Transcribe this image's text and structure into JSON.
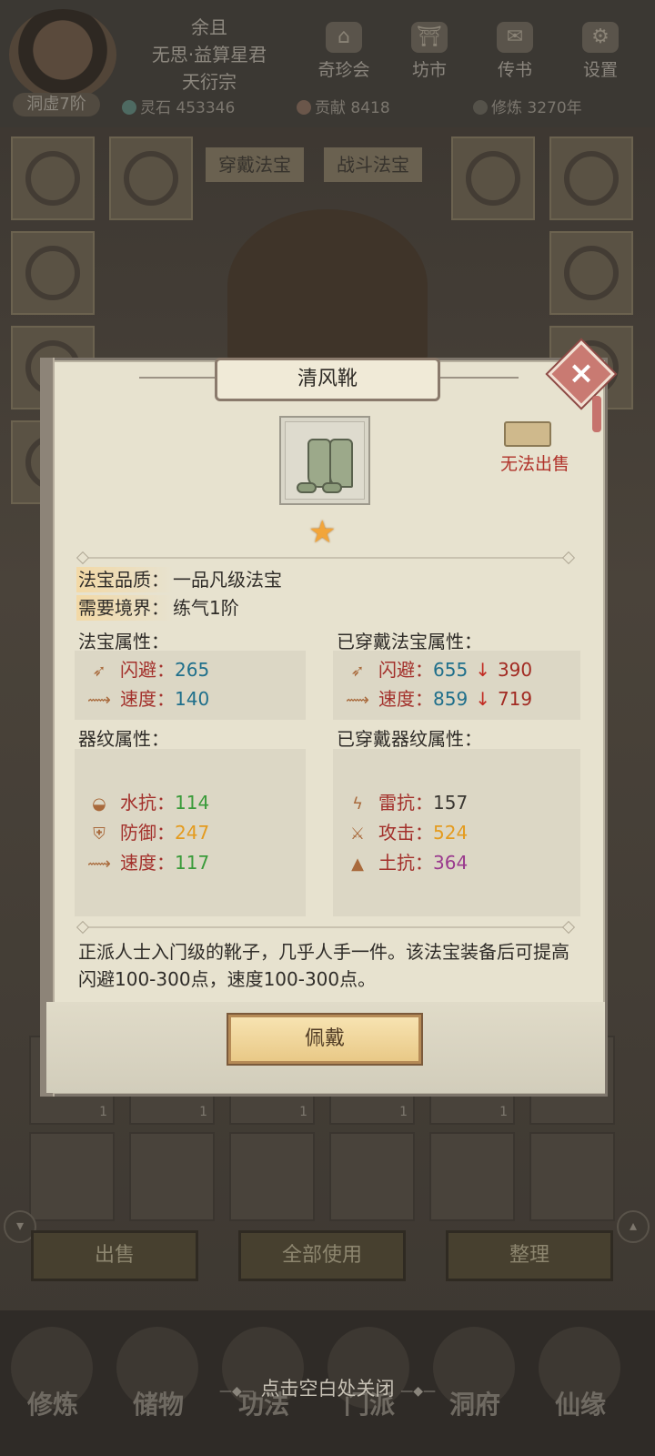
{
  "player": {
    "name": "余且",
    "title": "无思·益算星君",
    "sect": "天衍宗",
    "realm": "洞虚7阶"
  },
  "top_menu": [
    {
      "label": "奇珍会"
    },
    {
      "label": "坊市"
    },
    {
      "label": "传书"
    },
    {
      "label": "设置"
    }
  ],
  "stats": {
    "spirit_stone": "灵石 453346",
    "contribution": "贡献 8418",
    "cultivation": "修炼 3270年"
  },
  "equip_tabs": {
    "worn": "穿戴法宝",
    "battle": "战斗法宝"
  },
  "bag_buttons": {
    "sell": "出售",
    "use_all": "全部使用",
    "sort": "整理"
  },
  "bag_counts": [
    "1",
    "1",
    "1",
    "1",
    "1"
  ],
  "close_hint": "点击空白处关闭",
  "bottom_nav": [
    "修炼",
    "储物",
    "功法",
    "门派",
    "洞府",
    "仙缘"
  ],
  "modal": {
    "title": "清风靴",
    "sell_status": "无法出售",
    "quality_key": "法宝品质：",
    "quality_value": "一品凡级法宝",
    "realm_key": "需要境界：",
    "realm_value": "练气1阶",
    "item_attrs_title": "法宝属性：",
    "worn_attrs_title": "已穿戴法宝属性：",
    "item_attrs": [
      {
        "icon": "dodge-icon",
        "label": "闪避：",
        "value": "265"
      },
      {
        "icon": "speed-icon",
        "label": "速度：",
        "value": "140"
      }
    ],
    "worn_attrs": [
      {
        "icon": "dodge-icon",
        "label": "闪避：",
        "value": "655",
        "arrow": "↓",
        "diff": "390"
      },
      {
        "icon": "speed-icon",
        "label": "速度：",
        "value": "859",
        "arrow": "↓",
        "diff": "719"
      }
    ],
    "pattern_title": "器纹属性：",
    "worn_pattern_title": "已穿戴器纹属性：",
    "pattern_attrs": [
      {
        "icon": "water-resist-icon",
        "label": "水抗：",
        "value": "114",
        "color": "#3a9b3a"
      },
      {
        "icon": "defense-icon",
        "label": "防御：",
        "value": "247",
        "color": "#e49b1e"
      },
      {
        "icon": "speed-icon",
        "label": "速度：",
        "value": "117",
        "color": "#3a9b3a"
      }
    ],
    "worn_pattern_attrs": [
      {
        "icon": "thunder-resist-icon",
        "label": "雷抗：",
        "value": "157",
        "color": "#3b3833"
      },
      {
        "icon": "attack-icon",
        "label": "攻击：",
        "value": "524",
        "color": "#e49b1e"
      },
      {
        "icon": "earth-resist-icon",
        "label": "土抗：",
        "value": "364",
        "color": "#9a3a8e"
      }
    ],
    "description": "正派人士入门级的靴子，几乎人手一件。该法宝装备后可提高闪避100-300点，速度100-300点。",
    "wear_button": "佩戴"
  }
}
